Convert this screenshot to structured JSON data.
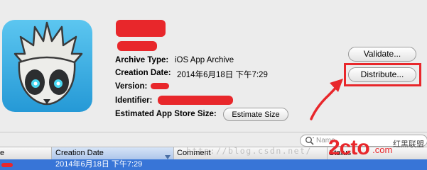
{
  "archive": {
    "type_label": "Archive Type:",
    "type_value": "iOS App Archive",
    "creation_label": "Creation Date:",
    "creation_value": "2014年6月18日 下午7:29",
    "version_label": "Version:",
    "identifier_label": "Identifier:",
    "size_label": "Estimated App Store Size:",
    "estimate_button": "Estimate Size"
  },
  "actions": {
    "validate": "Validate...",
    "distribute": "Distribute..."
  },
  "search": {
    "placeholder": "Name"
  },
  "table": {
    "columns": [
      "e",
      "Creation Date",
      "Comment",
      "Status"
    ],
    "selected_row": {
      "creation_date": "2014年6月18日 下午7:29"
    }
  },
  "watermark": {
    "url": "http://blog.csdn.net/",
    "logo_text": "2cto",
    "logo_domain": ".com",
    "logo_chinese": "红黑联盟"
  },
  "colors": {
    "accent_selection": "#3875d7",
    "annotation_red": "#e8272b",
    "icon_bg": "#3db0e8"
  },
  "icons": [
    "app-icon",
    "magnifier-icon",
    "sort-descending-icon"
  ]
}
